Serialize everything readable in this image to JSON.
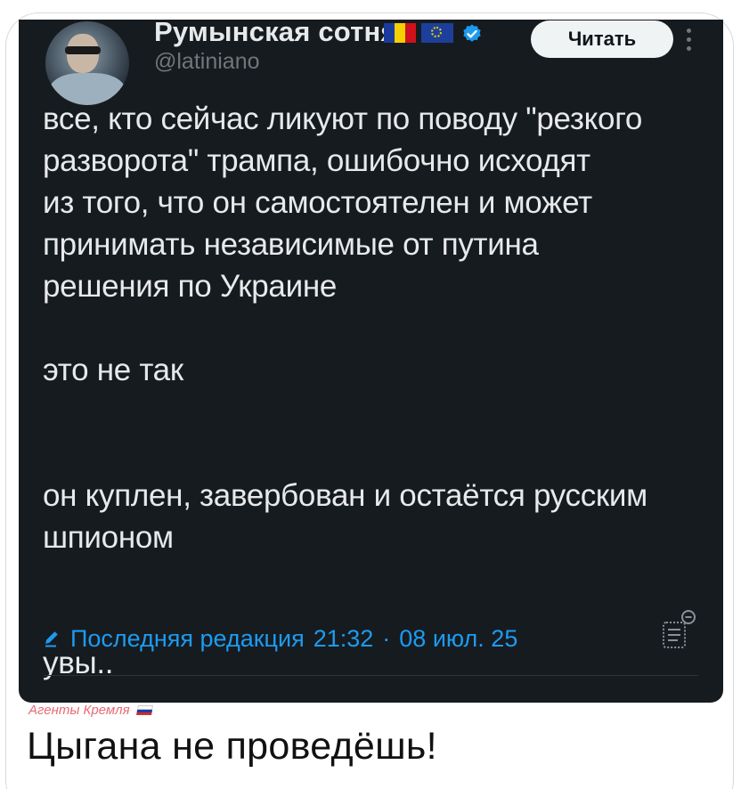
{
  "tweet": {
    "display_name": "Румынская сотня",
    "handle": "@latiniano",
    "follow_label": "Читать",
    "paragraphs": [
      "все, кто сейчас ликуют по поводу \"резкого\nразворота\" трампа, ошибочно исходят\nиз того, что он самостоятелен и может\nпринимать независимые от путина\nрешения по Украине",
      "это не так",
      "он куплен, завербован и остаётся русским\nшпионом",
      "увы.."
    ],
    "edit_label": "Последняя редакция",
    "edit_time": "21:32",
    "separator": "·",
    "edit_date": "08 июл. 25",
    "icons": {
      "verified": "verified-badge-icon",
      "more": "more-vertical-icon",
      "edit": "pencil-icon",
      "stats": "post-stats-icon"
    },
    "colors": {
      "background": "#161b20",
      "text": "#e7e9ea",
      "muted": "#71767b",
      "accent": "#1d9bf0"
    }
  },
  "post": {
    "watermark": "Агенты Кремля",
    "caption": "Цыгана не проведёшь!"
  }
}
